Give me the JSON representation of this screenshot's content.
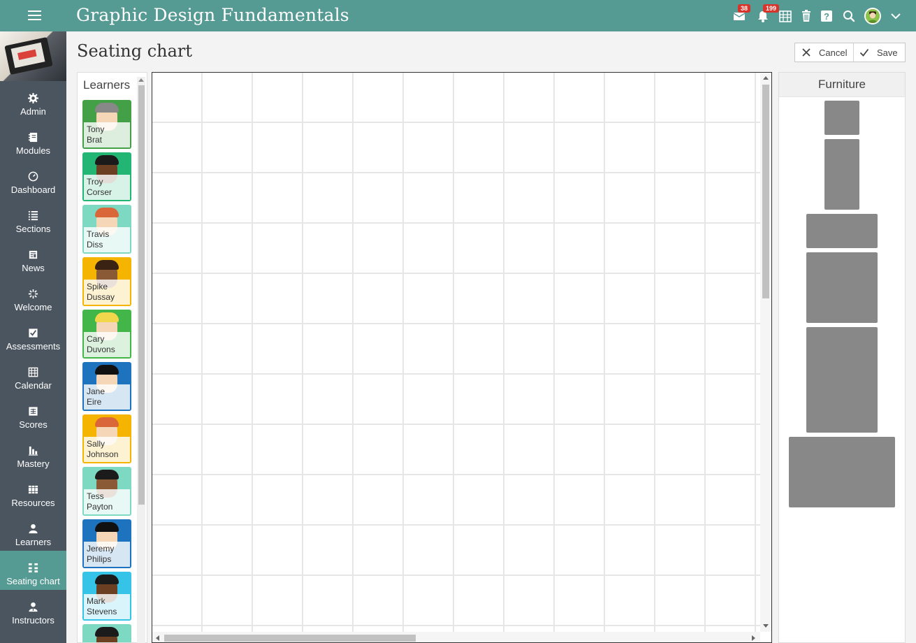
{
  "app": {
    "title": "Graphic Design Fundamentals"
  },
  "topbar": {
    "icons": [
      {
        "name": "mail-icon",
        "badge": "38"
      },
      {
        "name": "bell-icon",
        "badge": "199"
      },
      {
        "name": "calendar-grid-icon"
      },
      {
        "name": "trash-icon"
      },
      {
        "name": "help-icon"
      },
      {
        "name": "search-icon"
      },
      {
        "name": "user-avatar"
      },
      {
        "name": "chevron-down-icon"
      }
    ],
    "badge_color": "#d9342b",
    "bar_color": "#559a93"
  },
  "sidebar": {
    "active_color": "#559a93",
    "background": "#4b5560",
    "items": [
      {
        "label": "Admin",
        "icon": "gear-icon"
      },
      {
        "label": "Modules",
        "icon": "notebook-icon"
      },
      {
        "label": "Dashboard",
        "icon": "gauge-icon"
      },
      {
        "label": "Sections",
        "icon": "list-icon"
      },
      {
        "label": "News",
        "icon": "newspaper-icon"
      },
      {
        "label": "Welcome",
        "icon": "sparkle-icon"
      },
      {
        "label": "Assessments",
        "icon": "checkbox-icon"
      },
      {
        "label": "Calendar",
        "icon": "calendar-icon"
      },
      {
        "label": "Scores",
        "icon": "gradebook-icon"
      },
      {
        "label": "Mastery",
        "icon": "bar-chart-icon"
      },
      {
        "label": "Resources",
        "icon": "books-icon"
      },
      {
        "label": "Learners",
        "icon": "person-icon"
      },
      {
        "label": "Seating chart",
        "icon": "seating-icon",
        "active": true
      },
      {
        "label": "Instructors",
        "icon": "instructor-icon"
      }
    ]
  },
  "page": {
    "title": "Seating chart",
    "cancel_label": "Cancel",
    "save_label": "Save"
  },
  "learners": {
    "title": "Learners",
    "list": [
      {
        "first": "Tony",
        "last": "Brat",
        "color": "#43a047",
        "hair": "#888888",
        "skin": "#f5d7b8"
      },
      {
        "first": "Troy",
        "last": "Corser",
        "color": "#22b573",
        "hair": "#1b1b1b",
        "skin": "#6b3f22"
      },
      {
        "first": "Travis",
        "last": "Diss",
        "color": "#7ed9c3",
        "hair": "#d9673a",
        "skin": "#f5d7b8"
      },
      {
        "first": "Spike",
        "last": "Dussay",
        "color": "#f5b400",
        "hair": "#3b2314",
        "skin": "#8a5a36"
      },
      {
        "first": "Cary",
        "last": "Duvons",
        "color": "#43b649",
        "hair": "#f2d64b",
        "skin": "#f5d7b8"
      },
      {
        "first": "Jane",
        "last": "Eire",
        "color": "#1e73be",
        "hair": "#111111",
        "skin": "#f5d7b8"
      },
      {
        "first": "Sally",
        "last": "Johnson",
        "color": "#f5b400",
        "hair": "#d9673a",
        "skin": "#f5d7b8"
      },
      {
        "first": "Tess",
        "last": "Payton",
        "color": "#7ed9c3",
        "hair": "#1b1b1b",
        "skin": "#8a5a36"
      },
      {
        "first": "Jeremy",
        "last": "Philips",
        "color": "#1e73be",
        "hair": "#111111",
        "skin": "#f5d7b8"
      },
      {
        "first": "Mark",
        "last": "Stevens",
        "color": "#35c4e8",
        "hair": "#1b1b1b",
        "skin": "#6b3f22"
      },
      {
        "first": "",
        "last": "",
        "color": "#7ed9c3",
        "hair": "#1b1b1b",
        "skin": "#6b3f22"
      }
    ]
  },
  "furniture": {
    "title": "Furniture",
    "piece_color": "#888888",
    "pieces": [
      "small-square",
      "tall-narrow",
      "wide-short",
      "large-square",
      "large-tall",
      "extra-wide"
    ]
  }
}
